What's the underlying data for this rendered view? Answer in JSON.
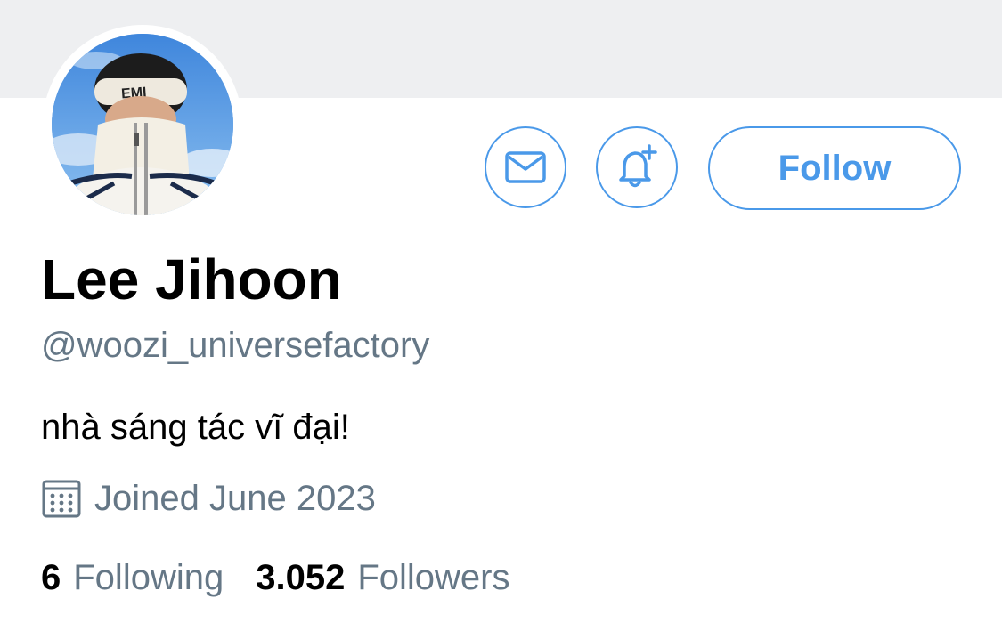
{
  "profile": {
    "display_name": "Lee Jihoon",
    "handle": "@woozi_universefactory",
    "bio": "nhà sáng tác vĩ đại!",
    "joined": "Joined June 2023"
  },
  "actions": {
    "message_icon": "envelope-icon",
    "notify_icon": "bell-plus-icon",
    "follow_label": "Follow"
  },
  "stats": {
    "following_count": "6",
    "following_label": "Following",
    "followers_count": "3.052",
    "followers_label": "Followers"
  },
  "colors": {
    "accent": "#4a99e9",
    "secondary_text": "#657786",
    "banner": "#eeeff1"
  }
}
